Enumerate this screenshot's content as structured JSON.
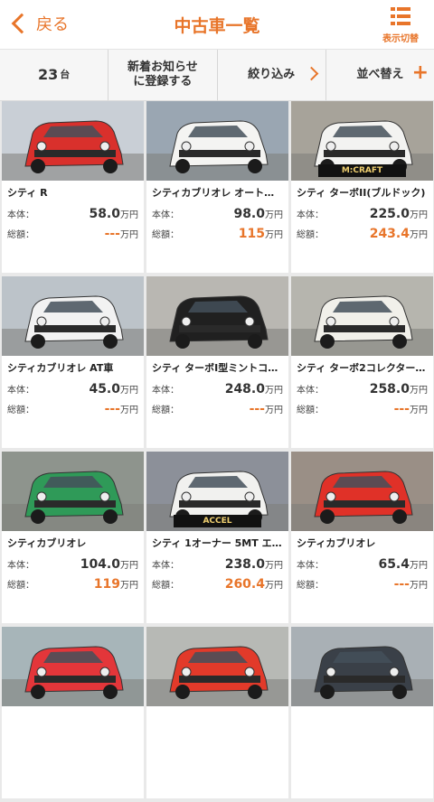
{
  "header": {
    "back_label": "戻る",
    "title": "中古車一覧",
    "view_toggle_label": "表示切替"
  },
  "toolbar": {
    "count": "23",
    "count_unit": "台",
    "notify_line1": "新着お知らせ",
    "notify_line2": "に登録する",
    "filter_label": "絞り込み",
    "sort_label": "並べ替え"
  },
  "labels": {
    "base": "本体：",
    "total": "総額：",
    "yen": "万円"
  },
  "colors": {
    "accent": "#e8752a"
  },
  "cards": [
    {
      "name": "シティ R",
      "base": "58.0",
      "total": "---",
      "car_color": "#d9302c",
      "bg": "#c9cfd6",
      "banner": ""
    },
    {
      "name": "シティカブリオレ オートマ…",
      "base": "98.0",
      "total": "115",
      "car_color": "#f4f4f2",
      "bg": "#9aa6b2",
      "banner": ""
    },
    {
      "name": "シティ ターボII(ブルドック)",
      "base": "225.0",
      "total": "243.4",
      "car_color": "#f3f3f1",
      "bg": "#a7a39a",
      "banner": "M:CRAFT"
    },
    {
      "name": "シティカブリオレ AT車",
      "base": "45.0",
      "total": "---",
      "car_color": "#f2f2f2",
      "bg": "#bcc3c9",
      "banner": ""
    },
    {
      "name": "シティ ターボI型ミントコン…",
      "base": "248.0",
      "total": "---",
      "car_color": "#202020",
      "bg": "#b9b7b2",
      "banner": ""
    },
    {
      "name": "シティ ターボ2コレクター…",
      "base": "258.0",
      "total": "---",
      "car_color": "#f1f0ea",
      "bg": "#b6b5ae",
      "banner": ""
    },
    {
      "name": "シティカブリオレ",
      "base": "104.0",
      "total": "119",
      "car_color": "#2f9a58",
      "bg": "#8e948d",
      "banner": ""
    },
    {
      "name": "シティ 1オーナー 5MT エ…",
      "base": "238.0",
      "total": "260.4",
      "car_color": "#f1f1ef",
      "bg": "#8c9099",
      "banner": "ACCEL"
    },
    {
      "name": "シティカブリオレ",
      "base": "65.4",
      "total": "---",
      "car_color": "#e03128",
      "bg": "#9a8f86",
      "banner": ""
    },
    {
      "name": "",
      "base": "",
      "total": "",
      "car_color": "#e3363a",
      "bg": "#a7b5b9",
      "banner": ""
    },
    {
      "name": "",
      "base": "",
      "total": "",
      "car_color": "#e23a2a",
      "bg": "#b7b9b5",
      "banner": ""
    },
    {
      "name": "",
      "base": "",
      "total": "",
      "car_color": "#3a4048",
      "bg": "#a9b0b5",
      "banner": ""
    }
  ]
}
